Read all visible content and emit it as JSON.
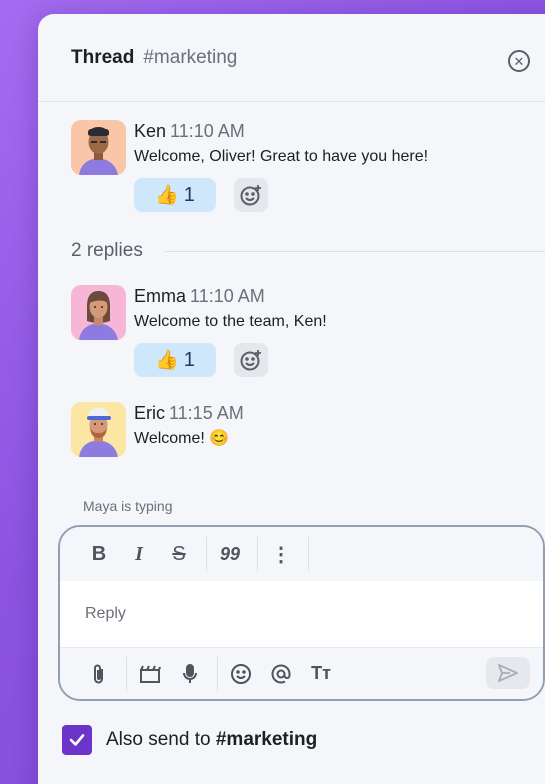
{
  "header": {
    "title": "Thread",
    "channel": "#marketing"
  },
  "messages": [
    {
      "name": "Ken",
      "time": "11:10 AM",
      "text": "Welcome, Oliver! Great to have you here!",
      "reaction": {
        "emoji": "👍",
        "count": "1"
      },
      "avatar_bg": "#f9c6a8"
    },
    {
      "name": "Emma",
      "time": "11:10 AM",
      "text": "Welcome to the team, Ken!",
      "reaction": {
        "emoji": "👍",
        "count": "1"
      },
      "avatar_bg": "#f7b6d6"
    },
    {
      "name": "Eric",
      "time": "11:15 AM",
      "text": "Welcome! 😊",
      "avatar_bg": "#fbe6a3"
    }
  ],
  "replies_label": "2 replies",
  "typing_indicator": "Maya is typing",
  "composer": {
    "placeholder": "Reply",
    "format_buttons": {
      "bold": "B",
      "italic": "I",
      "strike": "S",
      "quote": "99",
      "more": "⋮"
    },
    "bottom_icons": [
      "paperclip-icon",
      "clapperboard-icon",
      "microphone-icon",
      "smiley-icon",
      "at-icon",
      "text-format-icon"
    ],
    "text_format_label": "Tт"
  },
  "also_send": {
    "prefix": "Also send to",
    "channel": "#marketing",
    "checked": true
  },
  "colors": {
    "accent": "#6c34c8",
    "reaction_bg": "#cfe7fb",
    "background": "#8b53e0"
  }
}
